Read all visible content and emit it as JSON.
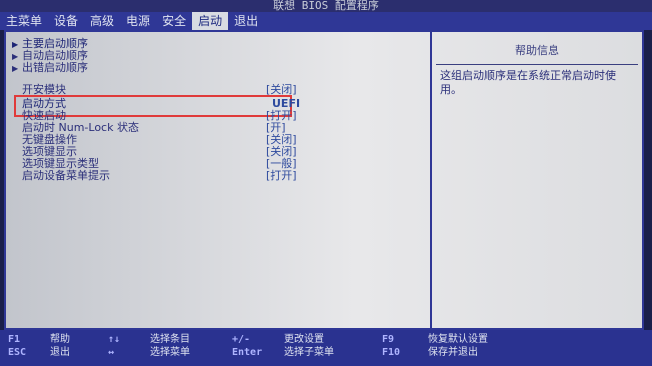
{
  "title": "联想 BIOS 配置程序",
  "menu": [
    {
      "label": "主菜单"
    },
    {
      "label": "设备"
    },
    {
      "label": "高级"
    },
    {
      "label": "电源"
    },
    {
      "label": "安全"
    },
    {
      "label": "启动"
    },
    {
      "label": "退出"
    }
  ],
  "active_menu": "启动",
  "submenus": [
    {
      "label": "主要启动顺序"
    },
    {
      "label": "自动启动顺序"
    },
    {
      "label": "出错启动顺序"
    }
  ],
  "settings": [
    {
      "label": "开安模块",
      "value": "[关闭]"
    },
    {
      "label": "启动方式",
      "value": "UEFI"
    },
    {
      "label": "快速启动",
      "value": "[打开]"
    },
    {
      "label": "启动时 Num-Lock 状态",
      "value": "[开]"
    },
    {
      "label": "无键盘操作",
      "value": "[关闭]"
    },
    {
      "label": "选项键显示",
      "value": "[关闭]"
    },
    {
      "label": "选项键显示类型",
      "value": "[一般]"
    },
    {
      "label": "启动设备菜单提示",
      "value": "[打开]"
    }
  ],
  "help": {
    "title": "帮助信息",
    "text": "这组启动顺序是在系统正常启动时使用。"
  },
  "footer": {
    "f1_key": "F1",
    "f1_desc": "帮助",
    "esc_key": "ESC",
    "esc_desc": "退出",
    "arrow_ud": "↑↓",
    "arrow_ud_desc": "选择条目",
    "arrow_lr": "↔",
    "arrow_lr_desc": "选择菜单",
    "pm_key": "+/-",
    "pm_desc": "更改设置",
    "enter_key": "Enter",
    "enter_desc": "选择子菜单",
    "f9_key": "F9",
    "f9_desc": "恢复默认设置",
    "f10_key": "F10",
    "f10_desc": "保存并退出"
  },
  "colors": {
    "menubar": "#2f3796",
    "highlight_box": "#e03a3a",
    "panel": "#dcdde0"
  }
}
